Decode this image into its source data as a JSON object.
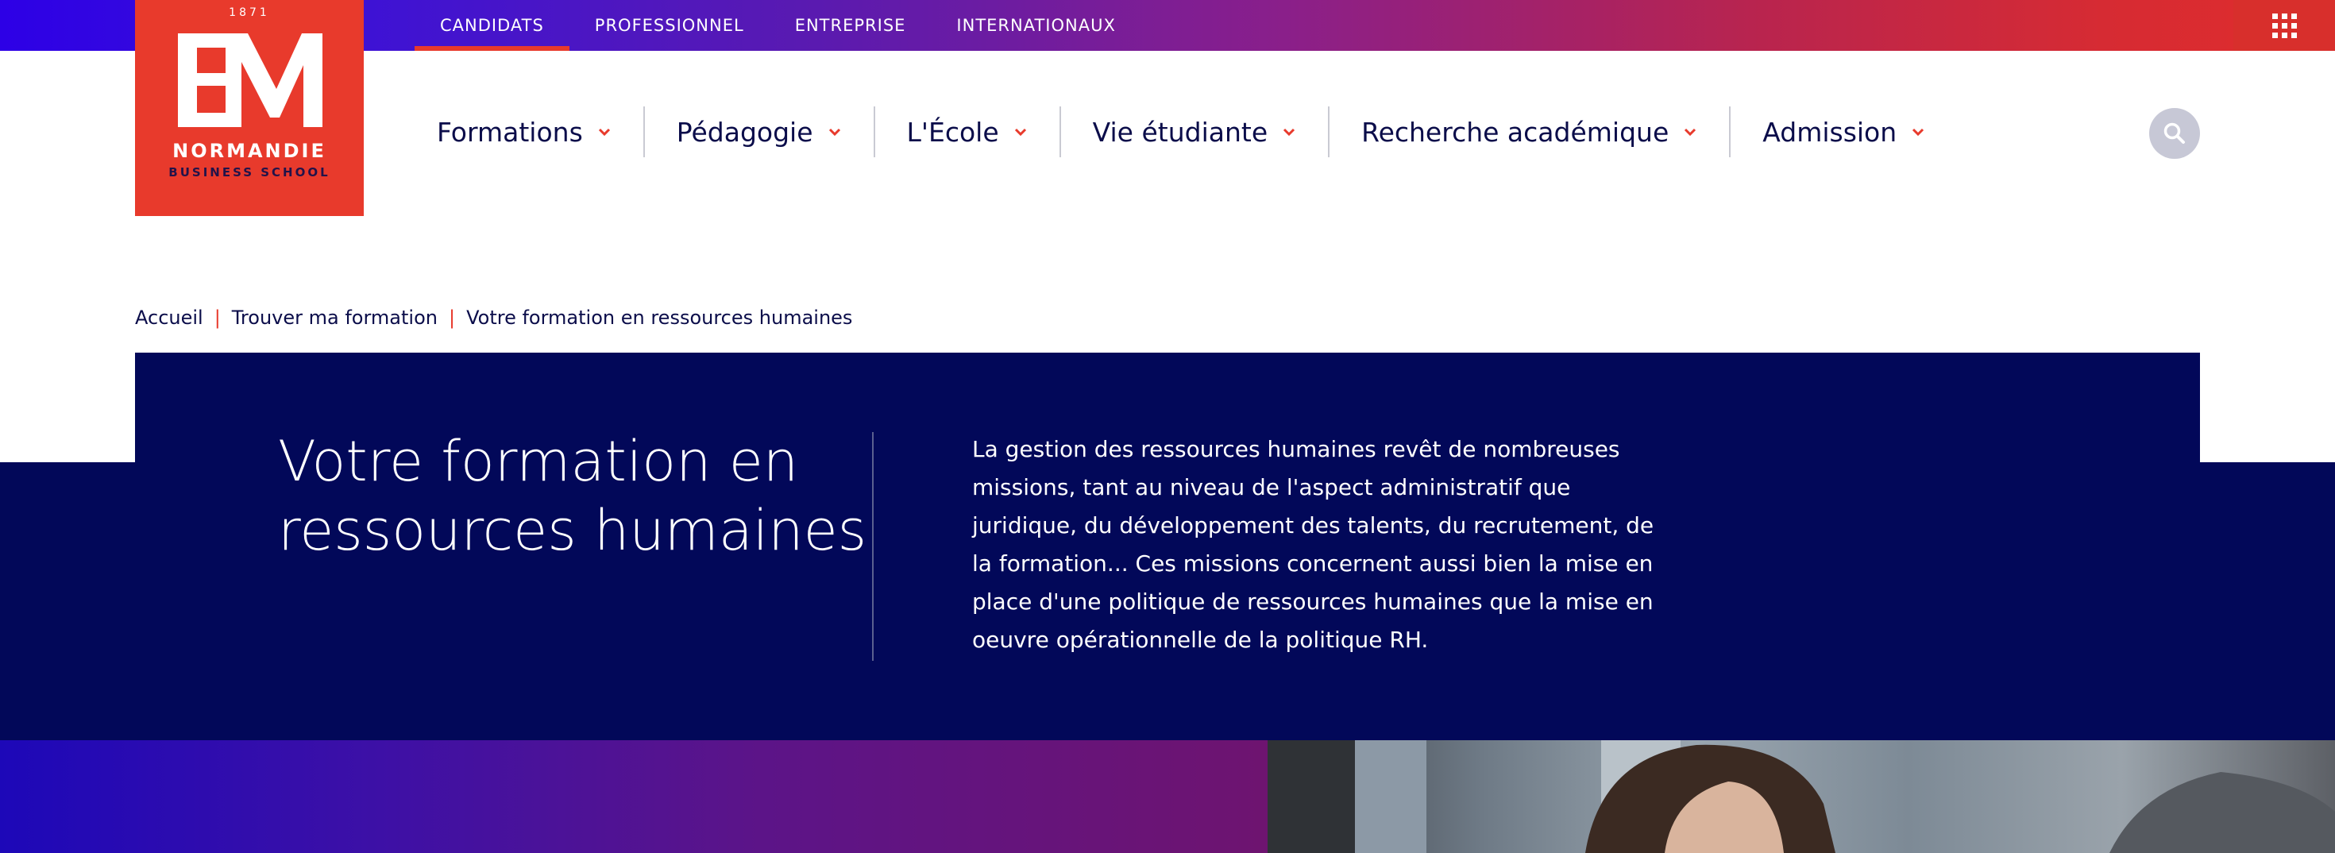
{
  "topnav": {
    "items": [
      {
        "label": "CANDIDATS",
        "active": true
      },
      {
        "label": "PROFESSIONNEL"
      },
      {
        "label": "ENTREPRISE"
      },
      {
        "label": "INTERNATIONAUX"
      }
    ]
  },
  "logo": {
    "year": "1871",
    "monogram": "EM",
    "name": "NORMANDIE",
    "subtitle": "BUSINESS SCHOOL"
  },
  "mainnav": {
    "items": [
      {
        "label": "Formations"
      },
      {
        "label": "Pédagogie"
      },
      {
        "label": "L'École"
      },
      {
        "label": "Vie étudiante"
      },
      {
        "label": "Recherche académique"
      },
      {
        "label": "Admission"
      }
    ]
  },
  "breadcrumb": {
    "items": [
      "Accueil",
      "Trouver ma formation",
      "Votre formation en ressources humaines"
    ]
  },
  "hero": {
    "title_line1": "Votre formation en",
    "title_line2": "ressources humaines",
    "description": "La gestion des ressources humaines revêt de nombreuses missions, tant au niveau de l'aspect administratif que juridique, du développement des talents, du recrutement, de la formation... Ces missions concernent aussi bien la mise en place d'une politique de ressources humaines que la mise en oeuvre opérationnelle de la politique RH."
  },
  "colors": {
    "brand_red": "#e83a2c",
    "navy": "#020859",
    "text_dark": "#0b0d4a"
  },
  "icons": {
    "search": "search-icon",
    "menu_grid": "grid-icon",
    "chevron": "chevron-down-icon"
  }
}
